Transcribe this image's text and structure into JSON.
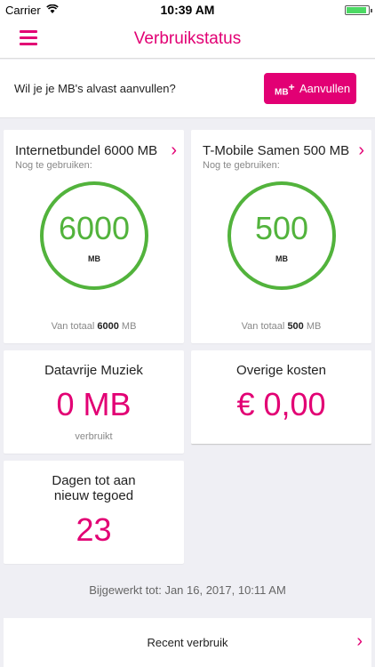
{
  "status_bar": {
    "carrier": "Carrier",
    "time": "10:39 AM"
  },
  "nav": {
    "title": "Verbruikstatus",
    "menu_icon": "hamburger-menu-icon"
  },
  "topup": {
    "prompt": "Wil je je MB's alvast aanvullen?",
    "button_label": "Aanvullen",
    "button_icon": "MB"
  },
  "bundles": [
    {
      "title": "Internetbundel 6000 MB",
      "subtitle": "Nog te gebruiken:",
      "remaining": "6000",
      "unit": "MB",
      "total_prefix": "Van totaal",
      "total_value": "6000",
      "total_unit": "MB"
    },
    {
      "title": "T-Mobile Samen 500 MB",
      "subtitle": "Nog te gebruiken:",
      "remaining": "500",
      "unit": "MB",
      "total_prefix": "Van totaal",
      "total_value": "500",
      "total_unit": "MB"
    }
  ],
  "music": {
    "title": "Datavrije Muziek",
    "value": "0 MB",
    "caption": "verbruikt"
  },
  "other_costs": {
    "title": "Overige kosten",
    "value": "€ 0,00"
  },
  "days": {
    "title_line1": "Dagen tot aan",
    "title_line2": "nieuw tegoed",
    "value": "23"
  },
  "updated": "Bijgewerkt tot: Jan 16, 2017, 10:11 AM",
  "recent": {
    "label": "Recent verbruik"
  },
  "colors": {
    "accent": "#e20074",
    "ring": "#52b33c"
  }
}
